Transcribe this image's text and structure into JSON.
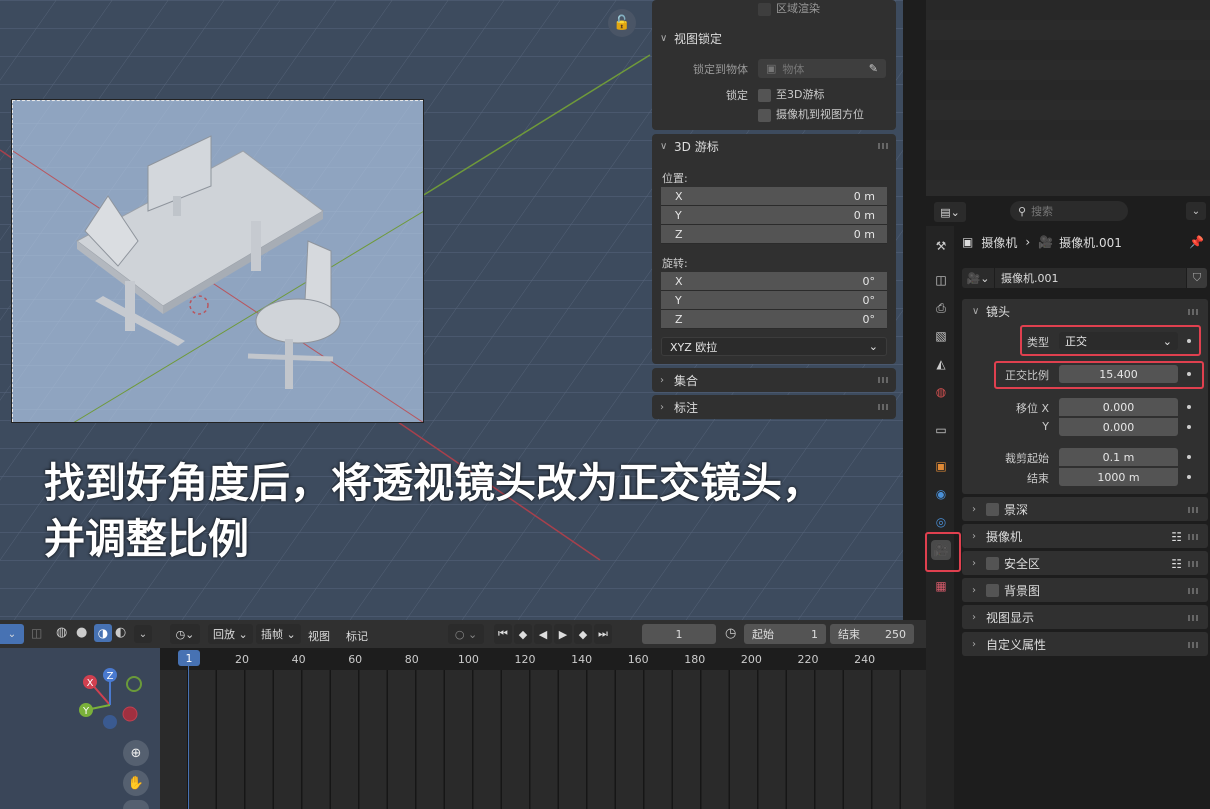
{
  "caption": {
    "line1": "找到好角度后，将透视镜头改为正交镜头，",
    "line2": "并调整比例"
  },
  "npanel": {
    "region_render_label": "区域渲染",
    "view_lock": {
      "header": "视图锁定",
      "lock_to_object_label": "锁定到物体",
      "lock_to_object_placeholder": "物体",
      "lock_label": "锁定",
      "lock_to_3d_cursor": "至3D游标",
      "camera_to_view": "摄像机到视图方位"
    },
    "cursor": {
      "header": "3D 游标",
      "location_label": "位置:",
      "location": [
        {
          "axis": "X",
          "value": "0 m"
        },
        {
          "axis": "Y",
          "value": "0 m"
        },
        {
          "axis": "Z",
          "value": "0 m"
        }
      ],
      "rotation_label": "旋转:",
      "rotation": [
        {
          "axis": "X",
          "value": "0°"
        },
        {
          "axis": "Y",
          "value": "0°"
        },
        {
          "axis": "Z",
          "value": "0°"
        }
      ],
      "rotation_mode": "XYZ 欧拉"
    },
    "collection_header": "集合",
    "annotation_header": "标注"
  },
  "properties": {
    "search_placeholder": "搜索",
    "breadcrumb_object": "摄像机",
    "breadcrumb_data": "摄像机.001",
    "datablock_name": "摄像机.001",
    "lens": {
      "header": "镜头",
      "type_label": "类型",
      "type_value": "正交",
      "ortho_scale_label": "正交比例",
      "ortho_scale_value": "15.400",
      "shift_label": "移位 X",
      "shift_x": "0.000",
      "shift_y_label": "Y",
      "shift_y": "0.000",
      "clip_start_label": "裁剪起始",
      "clip_start": "0.1 m",
      "clip_end_label": "结束",
      "clip_end": "1000 m"
    },
    "sections": {
      "dof": "景深",
      "camera": "摄像机",
      "safe_areas": "安全区",
      "background_images": "背景图",
      "viewport_display": "视图显示",
      "custom_properties": "自定义属性"
    }
  },
  "timeline": {
    "playback": "回放",
    "keying": "插帧",
    "view": "视图",
    "marker": "标记",
    "current_frame": "1",
    "start_label": "起始",
    "start_value": "1",
    "end_label": "结束",
    "end_value": "250",
    "ruler": [
      "1",
      "20",
      "40",
      "60",
      "80",
      "100",
      "120",
      "140",
      "160",
      "180",
      "200",
      "220",
      "240"
    ]
  },
  "gizmo": {
    "x": "X",
    "y": "Y",
    "z": "Z"
  },
  "colors": {
    "highlight": "#e0404f",
    "active_tab": "#4a9c6f",
    "frame_marker": "#4772b3"
  }
}
